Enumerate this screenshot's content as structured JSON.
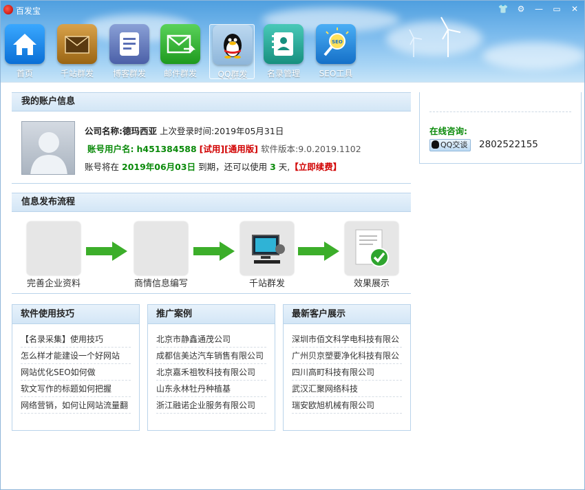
{
  "app": {
    "title": "百发宝"
  },
  "window_controls": [
    "shirt-icon",
    "gear-icon",
    "minimize-icon",
    "maximize-icon",
    "close-icon"
  ],
  "toolbar": [
    {
      "label": "首页",
      "icon": "home-icon"
    },
    {
      "label": "千站群发",
      "icon": "envelope-icon"
    },
    {
      "label": "博客群发",
      "icon": "document-icon"
    },
    {
      "label": "邮件群发",
      "icon": "mail-forward-icon"
    },
    {
      "label": "QQ群发",
      "icon": "qq-penguin-icon",
      "active": true
    },
    {
      "label": "名录管理",
      "icon": "contacts-icon"
    },
    {
      "label": "SEO工具",
      "icon": "seo-bulb-icon"
    }
  ],
  "account": {
    "title": "我的账户信息",
    "company_label": "公司名称:",
    "company": "德玛西亚",
    "last_login_label": "上次登录时间:",
    "last_login": "2019年05月31日",
    "username_label": "账号用户名:",
    "username": "h451384588",
    "trial_tag": "[试用]",
    "edition_tag": "[通用版]",
    "version_label": "软件版本:",
    "version": "9.0.2019.1102",
    "expire_pre": "账号将在",
    "expire_date": "2019年06月03日",
    "expire_mid": "到期，还可以使用",
    "days": "3",
    "days_unit": "天,",
    "renew": "【立即续费】"
  },
  "flow": {
    "title": "信息发布流程",
    "steps": [
      "完善企业资料",
      "商情信息编写",
      "千站群发",
      "效果展示"
    ]
  },
  "tips": {
    "title": "软件使用技巧",
    "items": [
      "【名录采集】使用技巧",
      "怎么样才能建设一个好网站",
      "网站优化SEO如何做",
      "软文写作的标题如何把握",
      "网络营销，如何让网站流量翻"
    ]
  },
  "cases": {
    "title": "推广案例",
    "items": [
      "北京市静鑫通茂公司",
      "成都信美达汽车销售有限公司",
      "北京嘉禾祖牧科技有限公司",
      "山东永林牡丹种植基",
      "浙江融诺企业服务有限公司"
    ]
  },
  "customers": {
    "title": "最新客户展示",
    "items": [
      "深圳市佰文科学电科技有限公",
      "广州贝京塑要净化科技有限公",
      "四川高町科技有限公司",
      "武汉汇聚网络科技",
      "瑞安欧旭机械有限公司"
    ]
  },
  "consult": {
    "label": "在线咨询:",
    "button": "QQ交谈",
    "number": "2802522155"
  }
}
